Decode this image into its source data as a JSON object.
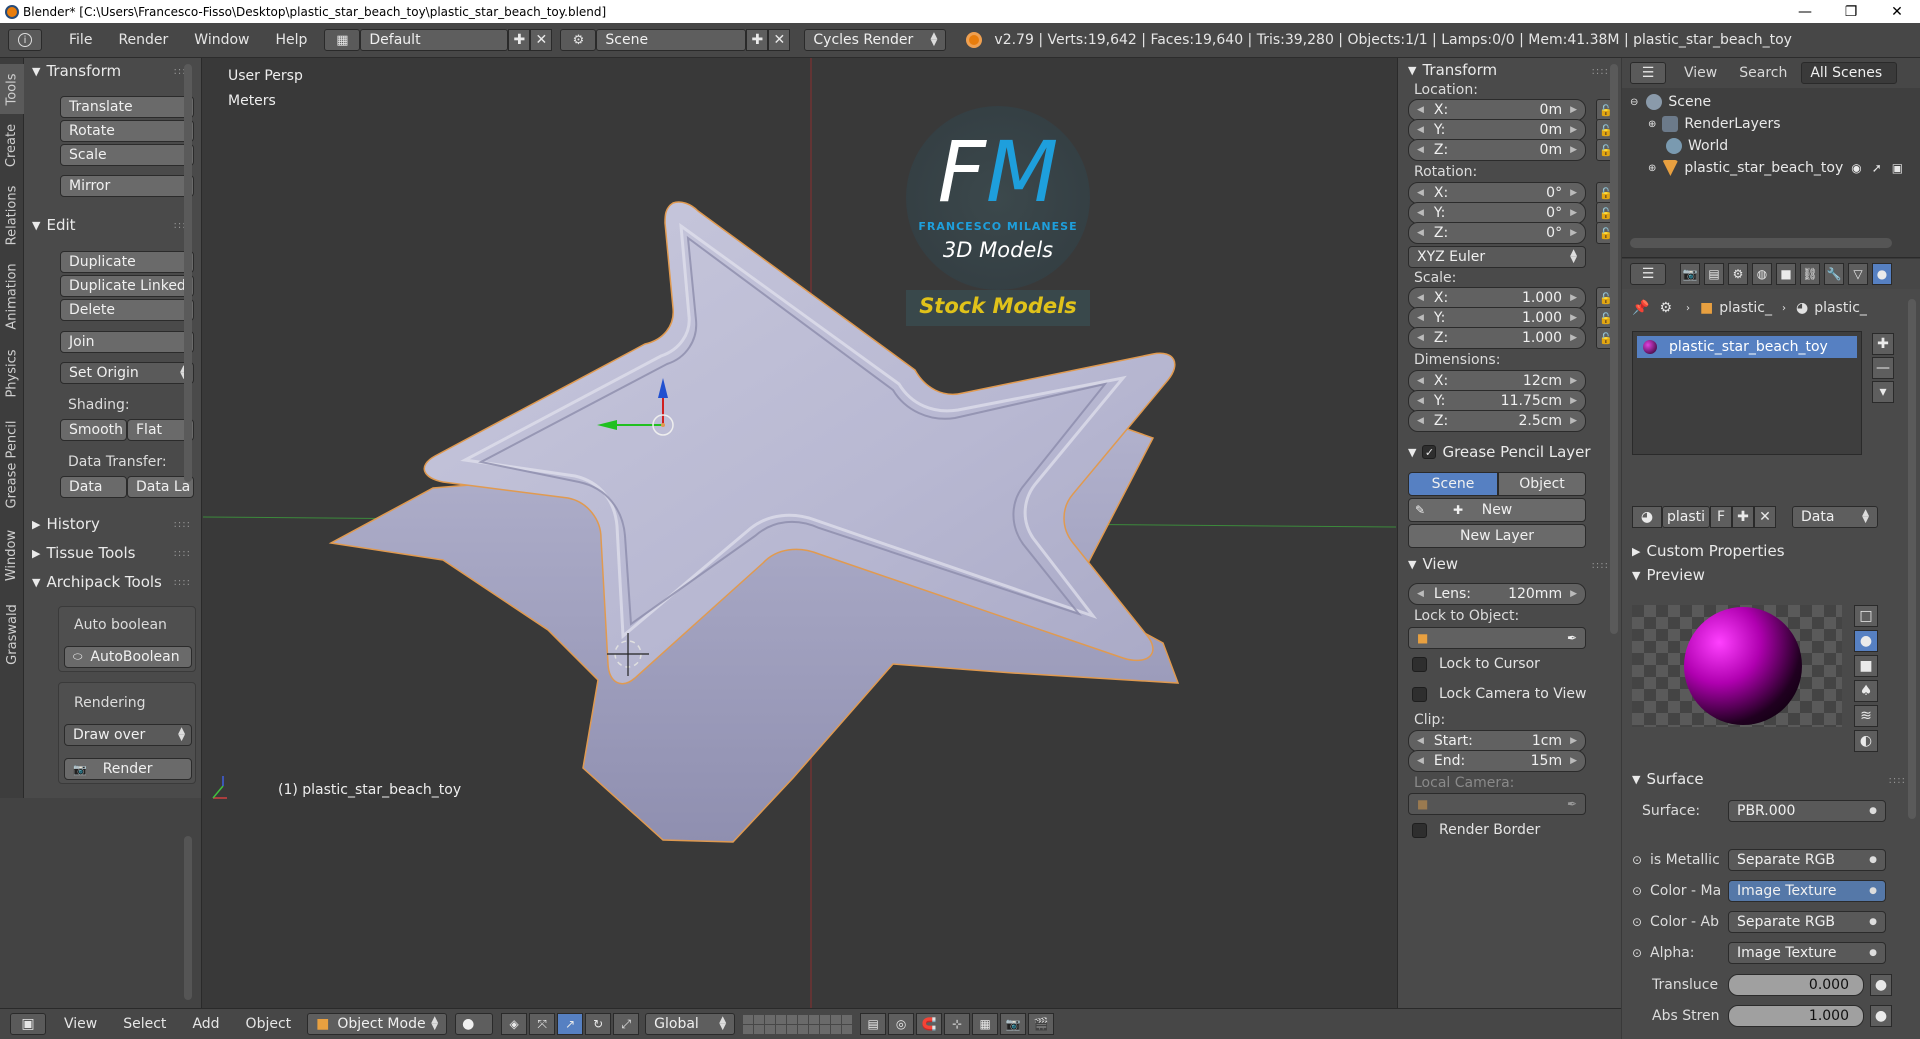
{
  "titlebar": {
    "title": "Blender* [C:\\Users\\Francesco-Fisso\\Desktop\\plastic_star_beach_toy\\plastic_star_beach_toy.blend]",
    "minimize": "—",
    "maximize": "❐",
    "close": "✕"
  },
  "infobar": {
    "menus": [
      "File",
      "Render",
      "Window",
      "Help"
    ],
    "layout": "Default",
    "scene": "Scene",
    "engine": "Cycles Render",
    "stats": "v2.79 | Verts:19,642 | Faces:19,640 | Tris:39,280 | Objects:1/1 | Lamps:0/0 | Mem:41.38M | plastic_star_beach_toy"
  },
  "lefttabs": [
    "Tools",
    "Create",
    "Relations",
    "Animation",
    "Physics",
    "Grease Pencil",
    "Window",
    "Graswald"
  ],
  "toolshelf": {
    "transform": {
      "title": "Transform",
      "buttons": [
        "Translate",
        "Rotate",
        "Scale",
        "Mirror"
      ]
    },
    "edit": {
      "title": "Edit",
      "buttons": [
        "Duplicate",
        "Duplicate Linked",
        "Delete",
        "Join"
      ],
      "set_origin": "Set Origin",
      "shading_label": "Shading:",
      "smooth": "Smooth",
      "flat": "Flat",
      "data_transfer_label": "Data Transfer:",
      "data": "Data",
      "data_layout": "Data La"
    },
    "history": "History",
    "tissue": "Tissue Tools",
    "archipack": "Archipack Tools",
    "auto_boolean_label": "Auto boolean",
    "auto_boolean_btn": "AutoBoolean",
    "rendering_label": "Rendering",
    "draw_over": "Draw over",
    "render_btn": "Render"
  },
  "viewport": {
    "view_name": "User Persp",
    "units": "Meters",
    "object_label": "(1) plastic_star_beach_toy",
    "logo_big": "FM",
    "logo_sub": "FRANCESCO MILANESE",
    "logo_3d": "3D Models",
    "logo_stock": "Stock Models"
  },
  "npanel": {
    "transform_title": "Transform",
    "location_label": "Location:",
    "location": {
      "x": "0m",
      "y": "0m",
      "z": "0m"
    },
    "rotation_label": "Rotation:",
    "rotation": {
      "x": "0°",
      "y": "0°",
      "z": "0°"
    },
    "rotation_mode": "XYZ Euler",
    "scale_label": "Scale:",
    "scale": {
      "x": "1.000",
      "y": "1.000",
      "z": "1.000"
    },
    "dimensions_label": "Dimensions:",
    "dimensions": {
      "x": "12cm",
      "y": "11.75cm",
      "z": "2.5cm"
    },
    "axis_x": "X:",
    "axis_y": "Y:",
    "axis_z": "Z:",
    "gp_title": "Grease Pencil Layer",
    "gp_scene": "Scene",
    "gp_object": "Object",
    "gp_new": "New",
    "gp_new_layer": "New Layer",
    "view_title": "View",
    "lens_label": "Lens:",
    "lens_value": "120mm",
    "lock_obj_label": "Lock to Object:",
    "lock_cursor": "Lock to Cursor",
    "lock_camera": "Lock Camera to View",
    "clip_label": "Clip:",
    "clip_start_label": "Start:",
    "clip_start": "1cm",
    "clip_end_label": "End:",
    "clip_end": "15m",
    "local_camera": "Local Camera:",
    "render_border": "Render Border"
  },
  "outliner": {
    "view": "View",
    "search": "Search",
    "all_scenes": "All Scenes",
    "rows": [
      "Scene",
      "RenderLayers",
      "World",
      "plastic_star_beach_toy"
    ]
  },
  "properties": {
    "crumb_obj": "plastic_",
    "crumb_mat": "plastic_",
    "material_slot": "plastic_star_beach_toy",
    "mat_name": "plasti",
    "mat_fake": "F",
    "data_select": "Data",
    "custom_props": "Custom Properties",
    "preview": "Preview",
    "surface_title": "Surface",
    "surface_label": "Surface:",
    "surface_value": "PBR.000",
    "inputs": [
      {
        "label": "is Metallic",
        "value": "Separate RGB",
        "hi": false
      },
      {
        "label": "Color - Ma",
        "value": "Image Texture",
        "hi": true
      },
      {
        "label": "Color - Ab",
        "value": "Separate RGB",
        "hi": false
      },
      {
        "label": "Alpha:",
        "value": "Image Texture",
        "hi": false
      }
    ],
    "transluce_label": "Transluce",
    "transluce_value": "0.000",
    "abs_label": "Abs Stren",
    "abs_value": "1.000"
  },
  "viewhdr": {
    "menus": [
      "View",
      "Select",
      "Add",
      "Object"
    ],
    "mode": "Object Mode",
    "orientation": "Global"
  },
  "colors": {
    "accent_blue": "#5680c2",
    "mesh_color": "#b9b9d4",
    "logo_blue": "#1e9fdc",
    "logo_yellow": "#e0c21a"
  }
}
